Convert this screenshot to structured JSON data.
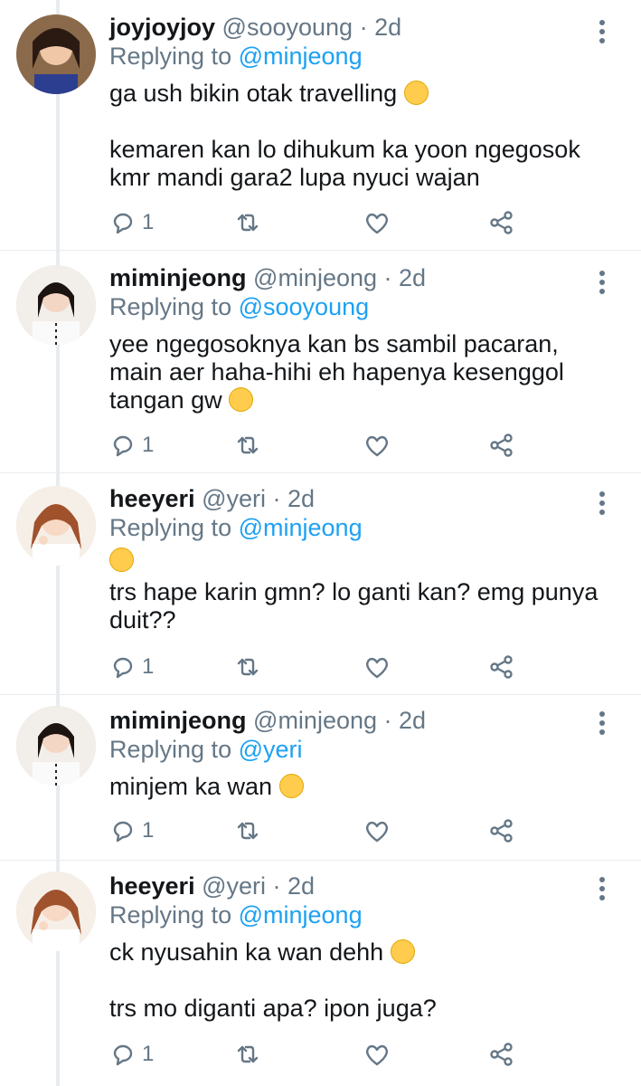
{
  "tweets": [
    {
      "name": "joyjoyjoy",
      "handle": "@sooyoung",
      "time": "· 2d",
      "replying_label": "Replying to",
      "replying_to": "@minjeong",
      "lines": [
        "ga ush bikin otak travelling",
        "",
        "kemaren kan lo dihukum ka yoon ngegosok",
        "kmr mandi gara2 lupa nyuci wajan"
      ],
      "reply_count": "1"
    },
    {
      "name": "miminjeong",
      "handle": "@minjeong",
      "time": "· 2d",
      "replying_label": "Replying to",
      "replying_to": "@sooyoung",
      "lines": [
        "yee ngegosoknya kan bs sambil pacaran,",
        "main aer haha-hihi eh hapenya kesenggol",
        "tangan gw"
      ],
      "reply_count": "1"
    },
    {
      "name": "heeyeri",
      "handle": "@yeri",
      "time": "· 2d",
      "replying_label": "Replying to",
      "replying_to": "@minjeong",
      "lines": [
        "trs hape karin gmn? lo ganti kan? emg punya",
        "duit??"
      ],
      "reply_count": "1"
    },
    {
      "name": "miminjeong",
      "handle": "@minjeong",
      "time": "· 2d",
      "replying_label": "Replying to",
      "replying_to": "@yeri",
      "lines": [
        "minjem ka wan"
      ],
      "reply_count": "1"
    },
    {
      "name": "heeyeri",
      "handle": "@yeri",
      "time": "· 2d",
      "replying_label": "Replying to",
      "replying_to": "@minjeong",
      "lines": [
        "ck nyusahin ka wan dehh",
        "",
        "trs mo diganti apa? ipon juga?"
      ],
      "reply_count": "1"
    }
  ],
  "icons": {
    "reply": "reply-icon",
    "retweet": "retweet-icon",
    "like": "heart-icon",
    "share": "share-icon",
    "more": "more-vertical-icon"
  },
  "colors": {
    "accent": "#1da1f2",
    "muted": "#657786",
    "text": "#14171a",
    "divider": "#e6ecf0"
  }
}
